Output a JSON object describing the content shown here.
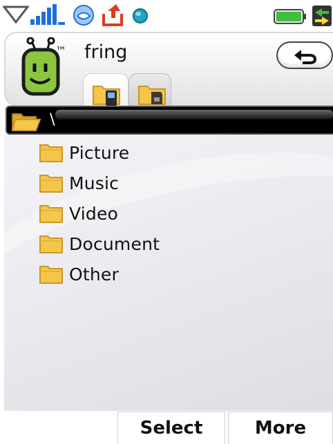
{
  "status_bar": {
    "icons": [
      "dropdown-arrow-icon",
      "signal-strength-icon",
      "messenger-icon",
      "upload-icon",
      "globe-icon",
      "battery-icon",
      "data-transfer-icon"
    ]
  },
  "header": {
    "app_name": "fring",
    "logo_mark": "™",
    "back_button_icon": "back-arrow-icon",
    "tabs": [
      {
        "icon": "phone-folder-icon",
        "active": true
      },
      {
        "icon": "memory-card-folder-icon",
        "active": false
      }
    ]
  },
  "path_bar": {
    "path": "\\"
  },
  "file_list": {
    "items": [
      {
        "label": "Picture"
      },
      {
        "label": "Music"
      },
      {
        "label": "Video"
      },
      {
        "label": "Document"
      },
      {
        "label": "Other"
      }
    ]
  },
  "softkeys": {
    "left_label": "Select",
    "right_label": "More"
  },
  "colors": {
    "folder_yellow": "#f6c64a",
    "folder_edge": "#c9962a",
    "logo_green": "#8cc63f",
    "path_bar_bg": "#000000",
    "status_blue": "#1e6fd9",
    "upload_red": "#e03a1e",
    "battery_green": "#3fbf3f"
  }
}
